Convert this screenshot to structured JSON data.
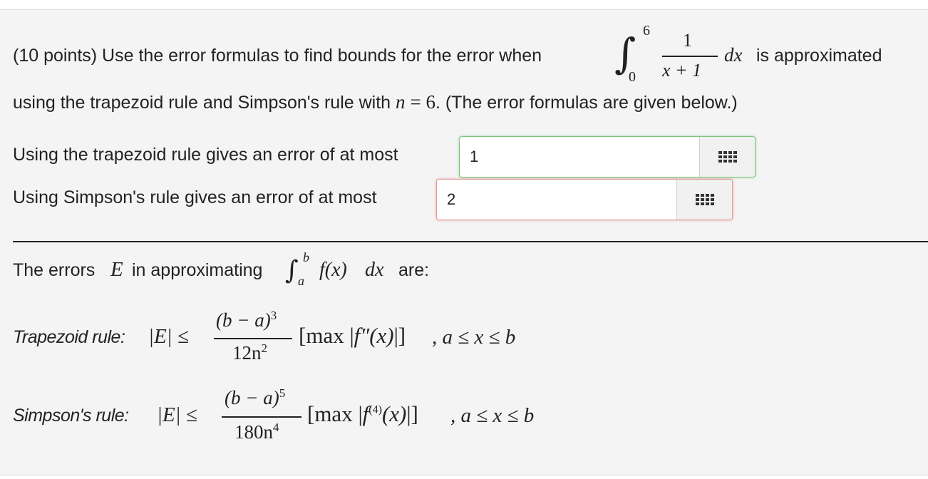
{
  "question": {
    "prefix": "(10 points) Use the error formulas to find bounds for the error when",
    "integral": {
      "upper": "6",
      "lower": "0",
      "numerator": "1",
      "denominator": "x + 1",
      "differential": "dx"
    },
    "suffix": "is approximated",
    "line2_a": "using the trapezoid rule and Simpson's rule with",
    "n_var": "n",
    "n_eq": "= 6",
    "line2_b": ". (The error formulas are given below.)"
  },
  "answers": [
    {
      "label": "Using the trapezoid rule gives an error of at most",
      "value": "1",
      "status": "correct"
    },
    {
      "label": "Using Simpson's rule gives an error of at most",
      "value": "2",
      "status": "incorrect"
    }
  ],
  "errors_intro": {
    "a": "The errors",
    "E": "E",
    "b": "in approximating",
    "upper": "b",
    "lower": "a",
    "fx": "f(x)",
    "dx": "dx",
    "c": "are:"
  },
  "trapezoid": {
    "label": "Trapezoid rule:",
    "lhs": "|E| ≤",
    "num": "(b − a)",
    "num_exp": "3",
    "den": "12n",
    "den_exp": "2",
    "bracket_open": "[max |",
    "f": "f″",
    "arg": "(x)",
    "bracket_close": "|]",
    "cond": ", a ≤ x ≤ b"
  },
  "simpson": {
    "label": "Simpson's rule:",
    "lhs": "|E| ≤",
    "num": "(b − a)",
    "num_exp": "5",
    "den": "180n",
    "den_exp": "4",
    "bracket_open": "[max |",
    "f": "f",
    "f_sup": "(4)",
    "arg": "(x)",
    "bracket_close": "|]",
    "cond": ", a ≤ x ≤ b"
  },
  "icons": {
    "keyboard": "grid-keyboard-icon"
  },
  "colors": {
    "correct_border": "#7cc47c",
    "incorrect_border": "#e49a9a",
    "panel_bg": "#f4f4f4"
  }
}
